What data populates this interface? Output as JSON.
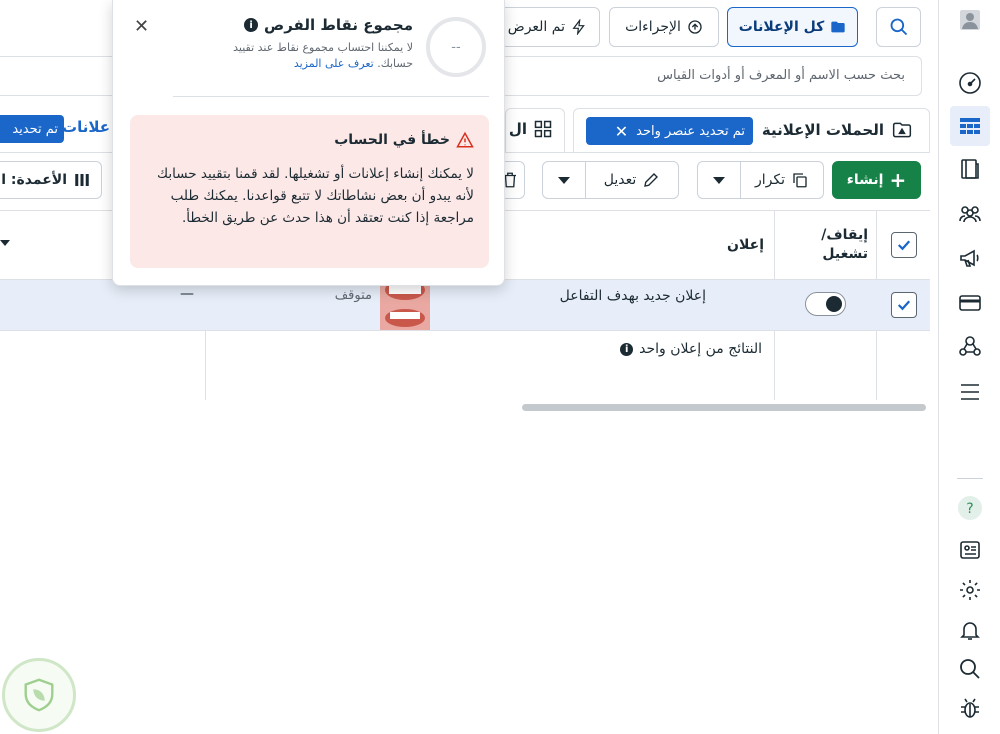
{
  "topbar": {
    "all_ads_label": "كل الإعلانات",
    "actions_label": "الإجراءات",
    "shown_label": "تم العرض"
  },
  "search": {
    "placeholder": "بحث حسب الاسم أو المعرف أو أدوات القياس"
  },
  "tabs": {
    "campaigns_label": "الحملات الإعلانية",
    "selected_chip": "تم تحديد عنصر واحد",
    "second_tab_partial": "ال",
    "ads_partial": "علانات",
    "ads_chip_partial": "تم تحديد"
  },
  "toolbar": {
    "create_label": "إنشاء",
    "duplicate_label": "تكرار",
    "edit_label": "تعديل",
    "columns_label": "الأعمدة: ال"
  },
  "table": {
    "headers": {
      "toggle": "إيقاف/ تشغيل",
      "ad": "إعلان"
    },
    "rows": [
      {
        "ad_name": "إعلان جديد بهدف التفاعل",
        "status": "متوقف",
        "extra": "—"
      }
    ],
    "results_label": "النتائج من إعلان واحد"
  },
  "popover": {
    "title": "مجموع نقاط الفرص",
    "score_value": "--",
    "description": "لا يمكننا احتساب مجموع نقاط عند تقييد حسابك.",
    "learn_more": "تعرف على المزيد",
    "error_title": "خطأ في الحساب",
    "error_body": "لا يمكنك إنشاء إعلانات أو تشغيلها. لقد قمنا بتقييد حسابك لأنه يبدو أن بعض نشاطاتك لا تتبع قواعدنا. يمكنك طلب مراجعة إذا كنت تعتقد أن هذا حدث عن طريق الخطأ."
  },
  "sidebar_icons": [
    "avatar-icon",
    "dashboard-gauge-icon",
    "ads-table-icon",
    "pages-icon",
    "audience-icon",
    "megaphone-icon",
    "billing-card-icon",
    "network-icon",
    "menu-icon",
    "help-icon",
    "news-icon",
    "settings-icon",
    "notifications-icon",
    "search-icon",
    "bug-icon"
  ],
  "colors": {
    "accent": "#1a66c9",
    "create_green": "#168247",
    "error_bg": "#fde8e8",
    "error_icon": "#d6311f"
  }
}
